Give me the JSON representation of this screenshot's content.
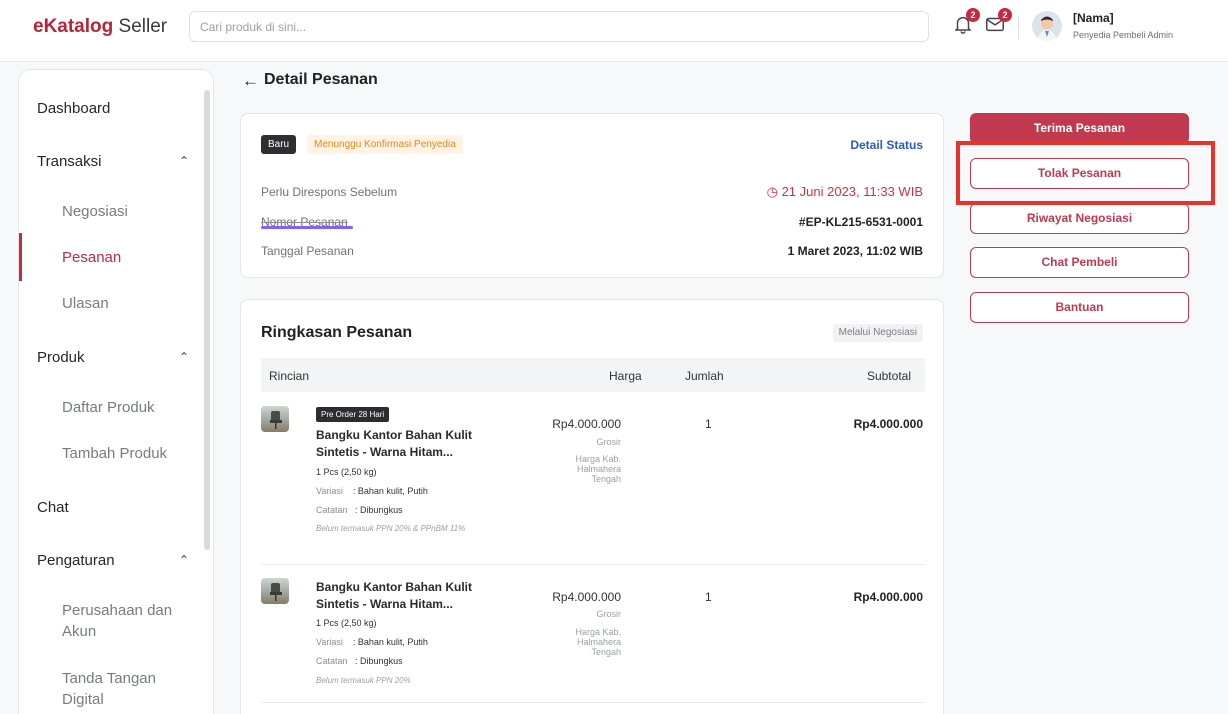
{
  "header": {
    "logo_brand": "eKatalog",
    "logo_suffix": "Seller",
    "search_placeholder": "Cari produk di sini...",
    "notification_count": "2",
    "message_count": "2",
    "user_name": "[Nama]",
    "user_role": "Penyedia Pembeli Admin"
  },
  "sidebar": {
    "dashboard": "Dashboard",
    "transaksi": "Transaksi",
    "negosiasi": "Negosiasi",
    "pesanan": "Pesanan",
    "ulasan": "Ulasan",
    "produk": "Produk",
    "daftar_produk": "Daftar Produk",
    "tambah_produk": "Tambah Produk",
    "chat": "Chat",
    "pengaturan": "Pengaturan",
    "perusahaan": "Perusahaan dan Akun",
    "tanda_tangan": "Tanda Tangan Digital"
  },
  "page": {
    "title": "Detail Pesanan"
  },
  "order": {
    "status_tag": "Baru",
    "status_text": "Menunggu Konfirmasi Penyedia",
    "detail_status_link": "Detail Status",
    "respond_label": "Perlu Direspons Sebelum",
    "respond_value": "21 Juni 2023, 11:33 WIB",
    "number_label": "Nomor Pesanan",
    "number_value": "#EP-KL215-6531-0001",
    "date_label": "Tanggal Pesanan",
    "date_value": "1 Maret 2023, 11:02 WIB"
  },
  "summary": {
    "title": "Ringkasan Pesanan",
    "via": "Melalui Negosiasi",
    "col_rincian": "Rincian",
    "col_harga": "Harga",
    "col_jumlah": "Jumlah",
    "col_subtotal": "Subtotal",
    "items": [
      {
        "preorder": "Pre Order 28 Hari",
        "name": "Bangku Kantor Bahan Kulit Sintetis - Warna Hitam...",
        "qty_weight": "1 Pcs (2,50 kg)",
        "variasi_label": "Variasi",
        "variasi_value": ": Bahan kulit, Putih",
        "catatan_label": "Catatan",
        "catatan_value": ": Dibungkus",
        "note": "Belum termasuk PPN 20% & PPnBM 11%",
        "price": "Rp4.000.000",
        "price_type": "Grosir",
        "price_area": "Harga Kab. Halmahera Tengah",
        "quantity": "1",
        "subtotal": "Rp4.000.000"
      },
      {
        "name": "Bangku Kantor Bahan Kulit Sintetis - Warna Hitam...",
        "qty_weight": "1 Pcs (2,50 kg)",
        "variasi_label": "Variasi",
        "variasi_value": ": Bahan kulit, Putih",
        "catatan_label": "Catatan",
        "catatan_value": ": Dibungkus",
        "note": "Belum termasuk PPN 20%",
        "price": "Rp4.000.000",
        "price_type": "Grosir",
        "price_area": "Harga Kab. Halmahera Tengah",
        "quantity": "1",
        "subtotal": "Rp4.000.000"
      }
    ]
  },
  "actions": {
    "accept": "Terima Pesanan",
    "reject": "Tolak Pesanan",
    "history": "Riwayat Negosiasi",
    "chat": "Chat Pembeli",
    "help": "Bantuan"
  },
  "colors": {
    "brand": "#c0394e",
    "highlight": "#e8332c",
    "link": "#2a59c7",
    "deadline": "#d5303e"
  }
}
